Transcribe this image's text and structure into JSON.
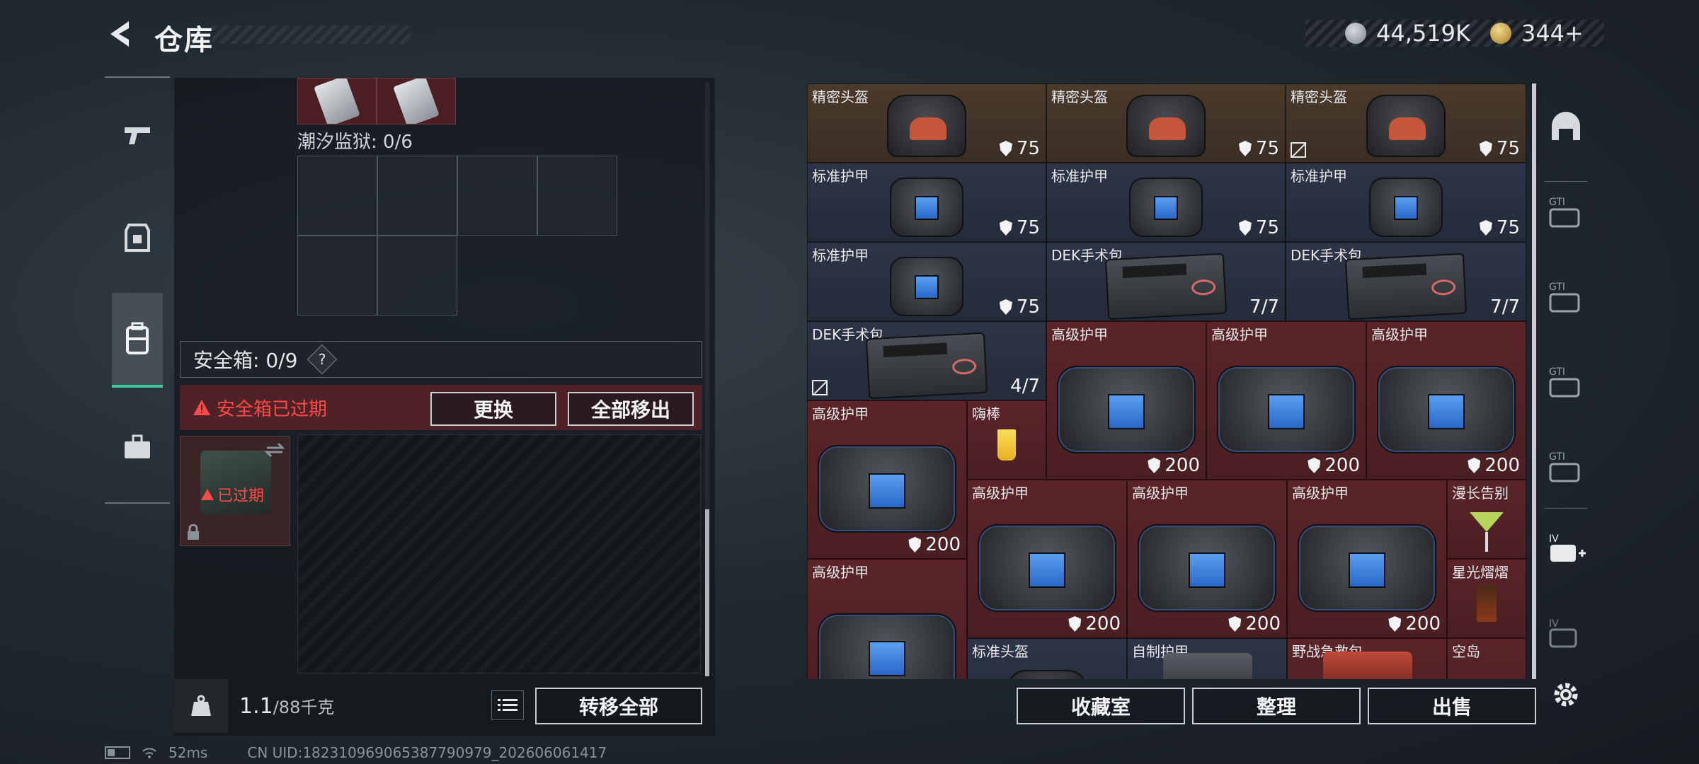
{
  "header": {
    "title": "仓库",
    "silver": "44,519K",
    "gold": "344+"
  },
  "top_chamber": {
    "label": "潮汐监狱: 0/6"
  },
  "safe_box": {
    "title": "安全箱: 0/9",
    "help": "?",
    "expired_msg": "安全箱已过期",
    "replace_label": "更换",
    "move_all_out_label": "全部移出",
    "badge": "已过期"
  },
  "footer_left": {
    "weight_current": "1.1",
    "weight_max": "/88千克",
    "transfer_all_label": "转移全部"
  },
  "footer_right": {
    "collection_label": "收藏室",
    "organize_label": "整理",
    "sell_label": "出售"
  },
  "inventory": {
    "items": [
      {
        "name": "精密头盔",
        "value": "75"
      },
      {
        "name": "精密头盔",
        "value": "75"
      },
      {
        "name": "精密头盔",
        "value": "75"
      },
      {
        "name": "标准护甲",
        "value": "75"
      },
      {
        "name": "标准护甲",
        "value": "75"
      },
      {
        "name": "标准护甲",
        "value": "75"
      },
      {
        "name": "标准护甲",
        "value": "75"
      },
      {
        "name": "DEK手术包",
        "value": "7/7"
      },
      {
        "name": "DEK手术包",
        "value": "7/7"
      },
      {
        "name": "DEK手术包",
        "value": "4/7"
      },
      {
        "name": "高级护甲",
        "value": "200"
      },
      {
        "name": "高级护甲",
        "value": "200"
      },
      {
        "name": "高级护甲",
        "value": "200"
      },
      {
        "name": "高级护甲",
        "value": "200"
      },
      {
        "name": "嗨棒",
        "value": ""
      },
      {
        "name": "高级护甲",
        "value": "200"
      },
      {
        "name": "高级护甲",
        "value": "200"
      },
      {
        "name": "高级护甲",
        "value": "200"
      },
      {
        "name": "漫长告别",
        "value": ""
      },
      {
        "name": "星光熠熠",
        "value": ""
      },
      {
        "name": "高级护甲",
        "value": ""
      },
      {
        "name": "标准头盔",
        "value": ""
      },
      {
        "name": "自制护甲",
        "value": ""
      },
      {
        "name": "野战急救包",
        "value": ""
      },
      {
        "name": "空岛",
        "value": ""
      }
    ]
  },
  "status_bar": {
    "ping": "52ms",
    "uid": "CN UID:182310969065387790979_202606061417"
  },
  "colors": {
    "accent": "#3ac99a",
    "danger": "#ff4a4a"
  }
}
